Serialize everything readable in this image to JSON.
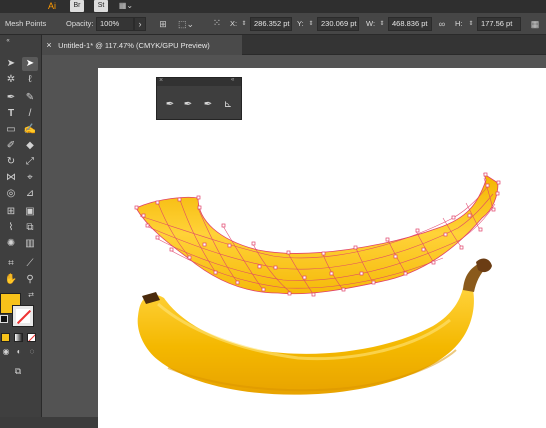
{
  "menubar": {
    "app_logo": "Ai",
    "bridge_label": "Br",
    "stock_label": "St"
  },
  "control_bar": {
    "selection_type": "Mesh Points",
    "opacity_label": "Opacity:",
    "opacity_value": "100%",
    "x_label": "X:",
    "x_value": "286.352 pt",
    "y_label": "Y:",
    "y_value": "230.069 pt",
    "w_label": "W:",
    "w_value": "468.836 pt",
    "h_label": "H:",
    "h_value": "177.56 pt"
  },
  "document": {
    "tab_title": "Untitled-1* @ 117.47% (CMYK/GPU Preview)",
    "close_glyph": "×"
  },
  "colors": {
    "fill": "#f7c21a",
    "stroke": "#ffffff",
    "mesh_line": "#e0406a",
    "banana_yellow": "#f2b600",
    "banana_stem": "#6b3d14"
  },
  "icons": [
    "selection-tool-icon",
    "direct-selection-tool-icon",
    "magic-wand-icon",
    "lasso-icon",
    "pen-tool-icon",
    "curvature-tool-icon",
    "type-tool-icon",
    "line-segment-icon",
    "rectangle-tool-icon",
    "paintbrush-icon",
    "shaper-tool-icon",
    "eraser-icon",
    "rotate-tool-icon",
    "scale-tool-icon",
    "width-tool-icon",
    "free-transform-icon",
    "shape-builder-icon",
    "perspective-grid-icon",
    "mesh-tool-icon",
    "gradient-tool-icon",
    "eyedropper-icon",
    "blend-tool-icon",
    "symbol-sprayer-icon",
    "column-graph-icon",
    "artboard-tool-icon",
    "slice-tool-icon",
    "hand-tool-icon",
    "zoom-tool-icon",
    "add-anchor-point-icon",
    "delete-anchor-point-icon",
    "anchor-point-tool-icon"
  ]
}
